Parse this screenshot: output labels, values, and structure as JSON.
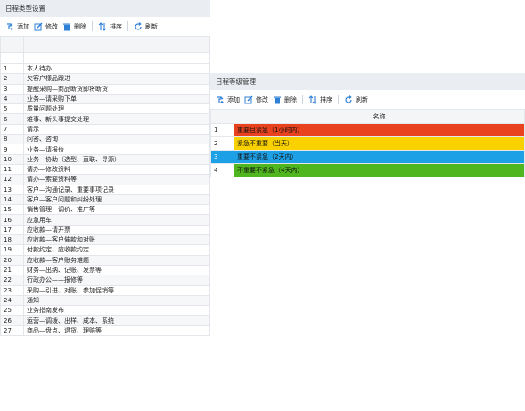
{
  "type_panel": {
    "title": "日程类型设置",
    "toolbar": {
      "add": "添加",
      "edit": "修改",
      "delete": "删除",
      "sort": "排序",
      "refresh": "刷新"
    },
    "rows": [
      {
        "idx": "1",
        "name": "本人待办"
      },
      {
        "idx": "2",
        "name": "欠客户樣品跟进"
      },
      {
        "idx": "3",
        "name": "提醒采购—商品断货即将断货"
      },
      {
        "idx": "4",
        "name": "业务—请采购下单"
      },
      {
        "idx": "5",
        "name": "质量问题处理"
      },
      {
        "idx": "6",
        "name": "难事、新头事提交处理"
      },
      {
        "idx": "7",
        "name": "请示"
      },
      {
        "idx": "8",
        "name": "问答、咨询"
      },
      {
        "idx": "9",
        "name": "业务—请报价"
      },
      {
        "idx": "10",
        "name": "业务—协助（选型、直联、寻源）"
      },
      {
        "idx": "11",
        "name": "请办—修改资料"
      },
      {
        "idx": "12",
        "name": "请办—索要资料等"
      },
      {
        "idx": "13",
        "name": "客户—沟通记录、重要事项记录"
      },
      {
        "idx": "14",
        "name": "客户—客户问题和纠纷处理"
      },
      {
        "idx": "15",
        "name": "销售管理—调价、推广等"
      },
      {
        "idx": "16",
        "name": "应急用车"
      },
      {
        "idx": "17",
        "name": "应收款—请开票"
      },
      {
        "idx": "18",
        "name": "应收款—客户催款和对账"
      },
      {
        "idx": "19",
        "name": "付款约定、应收款约定"
      },
      {
        "idx": "20",
        "name": "应收款—客户账务难题"
      },
      {
        "idx": "21",
        "name": "财务—出纳、记账、发票等"
      },
      {
        "idx": "22",
        "name": "行政办公——报修等"
      },
      {
        "idx": "23",
        "name": "采购—引进、对账、参加促销等"
      },
      {
        "idx": "24",
        "name": "通知"
      },
      {
        "idx": "25",
        "name": "业务指南发布"
      },
      {
        "idx": "26",
        "name": "运营—调拨、出样、成本、系统"
      },
      {
        "idx": "27",
        "name": "商品—盘点、退货、理赔等"
      }
    ]
  },
  "level_panel": {
    "title": "日程等级管理",
    "toolbar": {
      "add": "添加",
      "edit": "修改",
      "delete": "删除",
      "sort": "排序",
      "refresh": "刷新"
    },
    "column_header": "名称",
    "rows": [
      {
        "idx": "1",
        "name": "重要且紧急（1小时内）",
        "color": "#e8421e"
      },
      {
        "idx": "2",
        "name": "紧急不重要（当天）",
        "color": "#f9d000"
      },
      {
        "idx": "3",
        "name": "重要不紧急（2天内）",
        "color": "#1ea0e6"
      },
      {
        "idx": "4",
        "name": "不重要不紧急（4天内）",
        "color": "#4fb61f"
      }
    ]
  },
  "colors": {
    "icon_blue": "#2e7fd6",
    "header_bg": "#eaeef3"
  }
}
